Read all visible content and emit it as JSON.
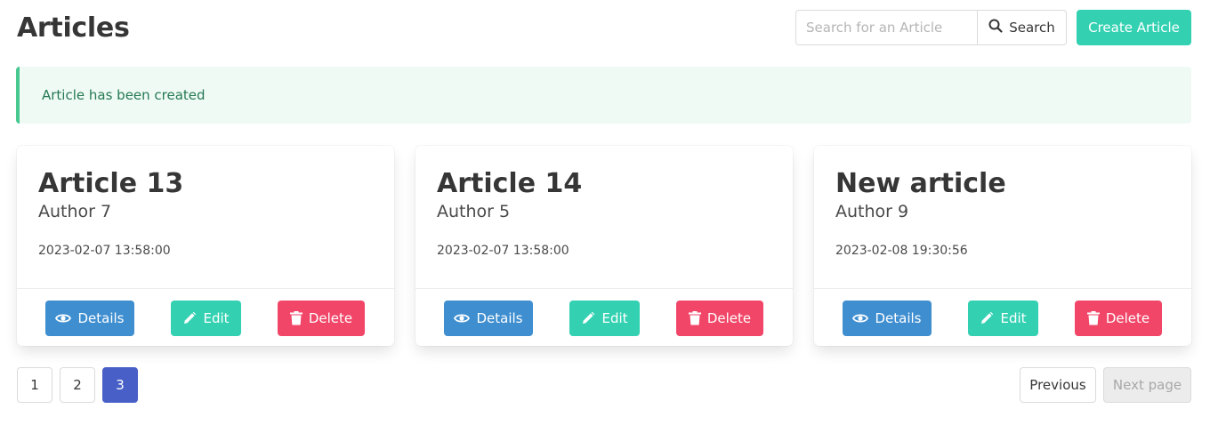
{
  "header": {
    "title": "Articles",
    "search_placeholder": "Search for an Article",
    "search_label": "Search",
    "create_label": "Create Article"
  },
  "notification": {
    "message": "Article has been created"
  },
  "articles": [
    {
      "title": "Article 13",
      "author": "Author 7",
      "date": "2023-02-07 13:58:00"
    },
    {
      "title": "Article 14",
      "author": "Author 5",
      "date": "2023-02-07 13:58:00"
    },
    {
      "title": "New article",
      "author": "Author 9",
      "date": "2023-02-08 19:30:56"
    }
  ],
  "actions": {
    "details_label": "Details",
    "edit_label": "Edit",
    "delete_label": "Delete"
  },
  "pagination": {
    "pages": [
      "1",
      "2",
      "3"
    ],
    "current_page": "3",
    "previous_label": "Previous",
    "next_label": "Next page"
  },
  "icons": {
    "search": "search-icon",
    "details": "eye-icon",
    "edit": "pencil-icon",
    "delete": "trash-icon"
  },
  "colors": {
    "primary": "#485fc7",
    "info": "#3e8ed0",
    "success_teal": "#33d1b2",
    "danger": "#f14668",
    "notification_bg": "#effaf5",
    "notification_border": "#48c78e",
    "notification_text": "#257953"
  }
}
